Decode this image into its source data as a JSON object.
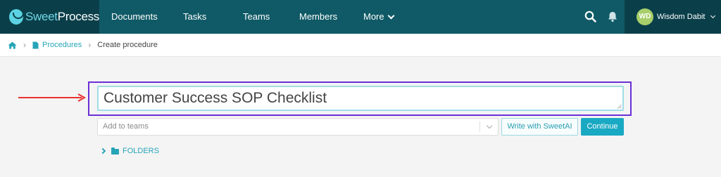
{
  "brand": {
    "logo_sweet": "Sweet",
    "logo_process": "Process",
    "logo_icon": "sweetprocess-cup-icon"
  },
  "nav": {
    "items": [
      {
        "label": "Documents"
      },
      {
        "label": "Tasks"
      },
      {
        "label": "Teams"
      },
      {
        "label": "Members"
      },
      {
        "label": "More"
      }
    ],
    "search_icon": "search-icon",
    "bell_icon": "bell-icon"
  },
  "user": {
    "initials": "WD",
    "name": "Wisdom Dabit"
  },
  "breadcrumb": {
    "home_icon": "home-icon",
    "procedures": "Procedures",
    "current": "Create procedure"
  },
  "form": {
    "title_value": "Customer Success SOP Checklist",
    "teams_placeholder": "Add to teams",
    "write_ai_label": "Write with SweetAI",
    "continue_label": "Continue",
    "folders_label": "FOLDERS"
  },
  "colors": {
    "nav_bg": "#0f5a66",
    "nav_dark": "#0a3f4a",
    "accent": "#1aa9c3",
    "link": "#27a5b8",
    "annotation_arrow": "#e8312f",
    "annotation_box": "#6b2fd6"
  }
}
